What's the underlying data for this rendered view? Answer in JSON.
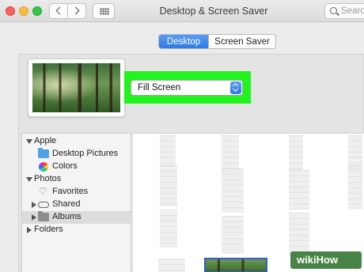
{
  "window": {
    "title": "Desktop & Screen Saver"
  },
  "search": {
    "placeholder": "Search"
  },
  "tabs": [
    {
      "label": "Desktop",
      "active": true
    },
    {
      "label": "Screen Saver",
      "active": false
    }
  ],
  "fill_popup": {
    "value": "Fill Screen",
    "highlight_color": "#22f21d"
  },
  "sidebar": {
    "items": [
      {
        "label": "Apple",
        "level": 0,
        "expanded": true
      },
      {
        "label": "Desktop Pictures",
        "level": 1,
        "icon": "folder-icon"
      },
      {
        "label": "Colors",
        "level": 1,
        "icon": "colors-icon"
      },
      {
        "label": "Photos",
        "level": 0,
        "expanded": true
      },
      {
        "label": "Favorites",
        "level": 1,
        "icon": "heart-icon"
      },
      {
        "label": "Shared",
        "level": 1,
        "icon": "cloud-icon",
        "expanded": false
      },
      {
        "label": "Albums",
        "level": 1,
        "icon": "folder-icon",
        "expanded": false,
        "selected": true
      },
      {
        "label": "Folders",
        "level": 0,
        "expanded": false
      }
    ]
  },
  "watermark": {
    "text": "wikiHow"
  },
  "colors": {
    "accent": "#2f7ae5",
    "folder": "#4fa3e2"
  }
}
